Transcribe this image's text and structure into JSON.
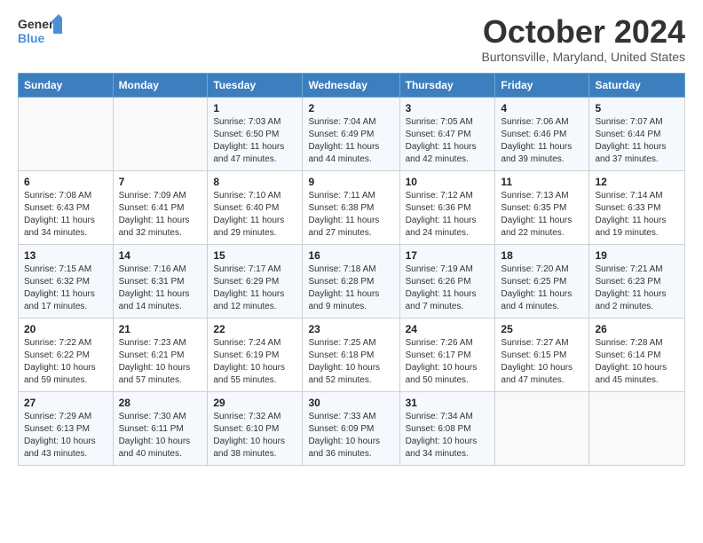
{
  "header": {
    "logo_line1": "General",
    "logo_line2": "Blue",
    "month_title": "October 2024",
    "subtitle": "Burtonsville, Maryland, United States"
  },
  "days_of_week": [
    "Sunday",
    "Monday",
    "Tuesday",
    "Wednesday",
    "Thursday",
    "Friday",
    "Saturday"
  ],
  "weeks": [
    [
      {
        "day": "",
        "info": ""
      },
      {
        "day": "",
        "info": ""
      },
      {
        "day": "1",
        "info": "Sunrise: 7:03 AM\nSunset: 6:50 PM\nDaylight: 11 hours and 47 minutes."
      },
      {
        "day": "2",
        "info": "Sunrise: 7:04 AM\nSunset: 6:49 PM\nDaylight: 11 hours and 44 minutes."
      },
      {
        "day": "3",
        "info": "Sunrise: 7:05 AM\nSunset: 6:47 PM\nDaylight: 11 hours and 42 minutes."
      },
      {
        "day": "4",
        "info": "Sunrise: 7:06 AM\nSunset: 6:46 PM\nDaylight: 11 hours and 39 minutes."
      },
      {
        "day": "5",
        "info": "Sunrise: 7:07 AM\nSunset: 6:44 PM\nDaylight: 11 hours and 37 minutes."
      }
    ],
    [
      {
        "day": "6",
        "info": "Sunrise: 7:08 AM\nSunset: 6:43 PM\nDaylight: 11 hours and 34 minutes."
      },
      {
        "day": "7",
        "info": "Sunrise: 7:09 AM\nSunset: 6:41 PM\nDaylight: 11 hours and 32 minutes."
      },
      {
        "day": "8",
        "info": "Sunrise: 7:10 AM\nSunset: 6:40 PM\nDaylight: 11 hours and 29 minutes."
      },
      {
        "day": "9",
        "info": "Sunrise: 7:11 AM\nSunset: 6:38 PM\nDaylight: 11 hours and 27 minutes."
      },
      {
        "day": "10",
        "info": "Sunrise: 7:12 AM\nSunset: 6:36 PM\nDaylight: 11 hours and 24 minutes."
      },
      {
        "day": "11",
        "info": "Sunrise: 7:13 AM\nSunset: 6:35 PM\nDaylight: 11 hours and 22 minutes."
      },
      {
        "day": "12",
        "info": "Sunrise: 7:14 AM\nSunset: 6:33 PM\nDaylight: 11 hours and 19 minutes."
      }
    ],
    [
      {
        "day": "13",
        "info": "Sunrise: 7:15 AM\nSunset: 6:32 PM\nDaylight: 11 hours and 17 minutes."
      },
      {
        "day": "14",
        "info": "Sunrise: 7:16 AM\nSunset: 6:31 PM\nDaylight: 11 hours and 14 minutes."
      },
      {
        "day": "15",
        "info": "Sunrise: 7:17 AM\nSunset: 6:29 PM\nDaylight: 11 hours and 12 minutes."
      },
      {
        "day": "16",
        "info": "Sunrise: 7:18 AM\nSunset: 6:28 PM\nDaylight: 11 hours and 9 minutes."
      },
      {
        "day": "17",
        "info": "Sunrise: 7:19 AM\nSunset: 6:26 PM\nDaylight: 11 hours and 7 minutes."
      },
      {
        "day": "18",
        "info": "Sunrise: 7:20 AM\nSunset: 6:25 PM\nDaylight: 11 hours and 4 minutes."
      },
      {
        "day": "19",
        "info": "Sunrise: 7:21 AM\nSunset: 6:23 PM\nDaylight: 11 hours and 2 minutes."
      }
    ],
    [
      {
        "day": "20",
        "info": "Sunrise: 7:22 AM\nSunset: 6:22 PM\nDaylight: 10 hours and 59 minutes."
      },
      {
        "day": "21",
        "info": "Sunrise: 7:23 AM\nSunset: 6:21 PM\nDaylight: 10 hours and 57 minutes."
      },
      {
        "day": "22",
        "info": "Sunrise: 7:24 AM\nSunset: 6:19 PM\nDaylight: 10 hours and 55 minutes."
      },
      {
        "day": "23",
        "info": "Sunrise: 7:25 AM\nSunset: 6:18 PM\nDaylight: 10 hours and 52 minutes."
      },
      {
        "day": "24",
        "info": "Sunrise: 7:26 AM\nSunset: 6:17 PM\nDaylight: 10 hours and 50 minutes."
      },
      {
        "day": "25",
        "info": "Sunrise: 7:27 AM\nSunset: 6:15 PM\nDaylight: 10 hours and 47 minutes."
      },
      {
        "day": "26",
        "info": "Sunrise: 7:28 AM\nSunset: 6:14 PM\nDaylight: 10 hours and 45 minutes."
      }
    ],
    [
      {
        "day": "27",
        "info": "Sunrise: 7:29 AM\nSunset: 6:13 PM\nDaylight: 10 hours and 43 minutes."
      },
      {
        "day": "28",
        "info": "Sunrise: 7:30 AM\nSunset: 6:11 PM\nDaylight: 10 hours and 40 minutes."
      },
      {
        "day": "29",
        "info": "Sunrise: 7:32 AM\nSunset: 6:10 PM\nDaylight: 10 hours and 38 minutes."
      },
      {
        "day": "30",
        "info": "Sunrise: 7:33 AM\nSunset: 6:09 PM\nDaylight: 10 hours and 36 minutes."
      },
      {
        "day": "31",
        "info": "Sunrise: 7:34 AM\nSunset: 6:08 PM\nDaylight: 10 hours and 34 minutes."
      },
      {
        "day": "",
        "info": ""
      },
      {
        "day": "",
        "info": ""
      }
    ]
  ]
}
